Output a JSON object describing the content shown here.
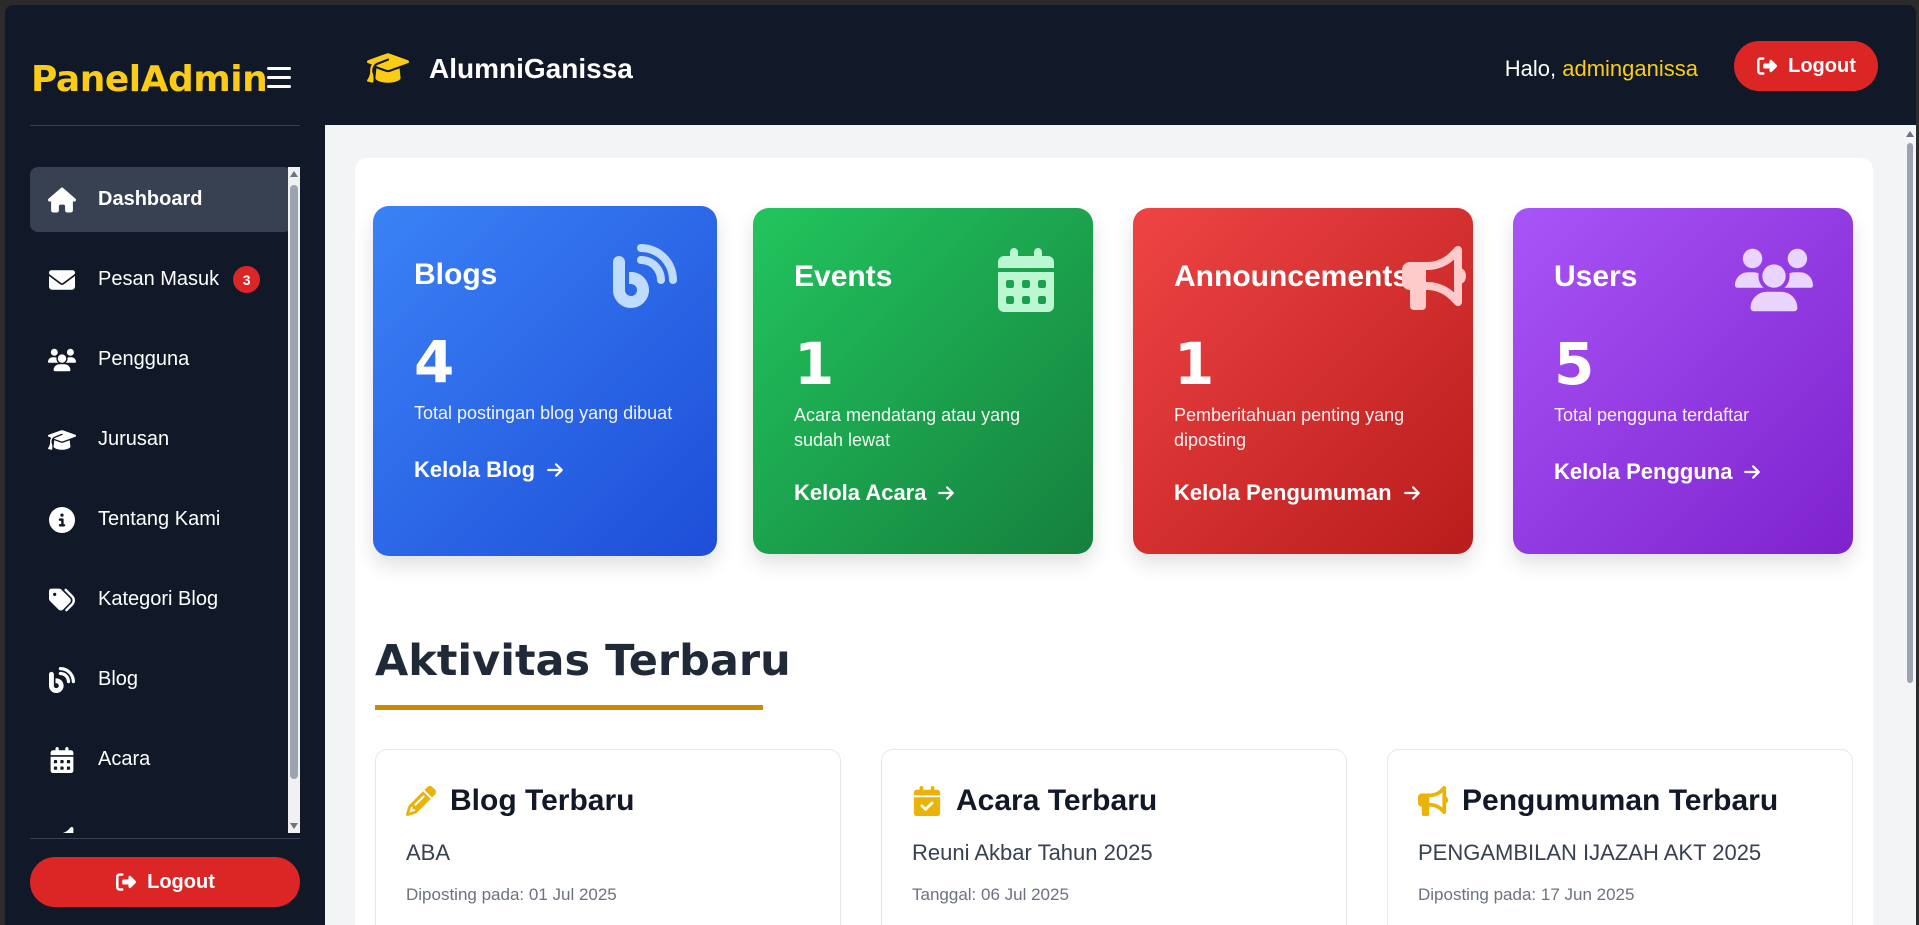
{
  "sidebar": {
    "brand": "PanelAdmin",
    "items": [
      {
        "label": "Dashboard",
        "icon": "home-icon",
        "active": true
      },
      {
        "label": "Pesan Masuk",
        "icon": "envelope-icon",
        "badge": "3"
      },
      {
        "label": "Pengguna",
        "icon": "users-icon"
      },
      {
        "label": "Jurusan",
        "icon": "graduation-cap-icon"
      },
      {
        "label": "Tentang Kami",
        "icon": "info-icon"
      },
      {
        "label": "Kategori Blog",
        "icon": "tags-icon"
      },
      {
        "label": "Blog",
        "icon": "blog-icon"
      },
      {
        "label": "Acara",
        "icon": "calendar-icon"
      }
    ],
    "logout_label": "Logout"
  },
  "topbar": {
    "app_title": "AlumniGanissa",
    "greeting_prefix": "Halo, ",
    "username": "adminganissa",
    "logout_label": "Logout"
  },
  "stats": {
    "blogs": {
      "title": "Blogs",
      "value": "4",
      "desc": "Total postingan blog yang dibuat",
      "link": "Kelola Blog",
      "icon": "blog-icon",
      "color": "#2563eb"
    },
    "events": {
      "title": "Events",
      "value": "1",
      "desc": "Acara mendatang atau yang sudah lewat",
      "link": "Kelola Acara",
      "icon": "calendar-icon",
      "color": "#16a34a"
    },
    "announcements": {
      "title": "Announcements",
      "value": "1",
      "desc": "Pemberitahuan penting yang diposting",
      "link": "Kelola Pengumuman",
      "icon": "bullhorn-icon",
      "color": "#dc2626"
    },
    "users": {
      "title": "Users",
      "value": "5",
      "desc": "Total pengguna terdaftar",
      "link": "Kelola Pengguna",
      "icon": "users-icon",
      "color": "#9333ea"
    }
  },
  "activity": {
    "title": "Aktivitas Terbaru",
    "blog": {
      "heading": "Blog Terbaru",
      "item": "ABA",
      "meta": "Diposting pada: 01 Jul 2025",
      "icon": "pencil-icon"
    },
    "event": {
      "heading": "Acara Terbaru",
      "item": "Reuni Akbar Tahun 2025",
      "meta": "Tanggal: 06 Jul 2025",
      "icon": "calendar-check-icon"
    },
    "announcement": {
      "heading": "Pengumuman Terbaru",
      "item": "PENGAMBILAN IJAZAH AKT 2025",
      "meta": "Diposting pada: 17 Jun 2025",
      "icon": "bullhorn-icon"
    }
  },
  "colors": {
    "accent": "#facc15",
    "danger": "#dc2626",
    "sidebar_bg": "#111827"
  }
}
